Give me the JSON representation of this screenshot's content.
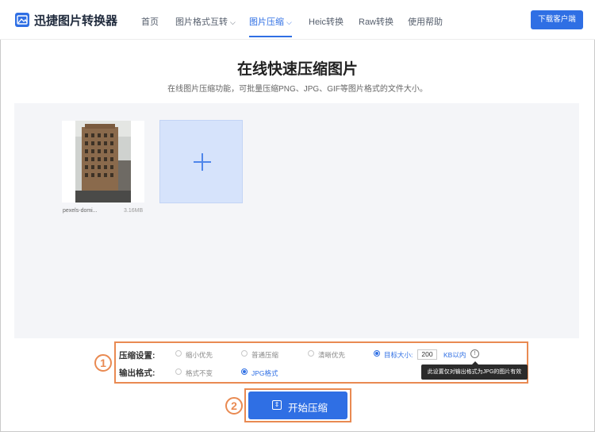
{
  "header": {
    "brand": "迅捷图片转换器",
    "nav": [
      {
        "label": "首页",
        "active": false,
        "dropdown": false
      },
      {
        "label": "图片格式互转",
        "active": false,
        "dropdown": true
      },
      {
        "label": "图片压缩",
        "active": true,
        "dropdown": true
      },
      {
        "label": "Heic转换",
        "active": false,
        "dropdown": false
      },
      {
        "label": "Raw转换",
        "active": false,
        "dropdown": false
      },
      {
        "label": "使用帮助",
        "active": false,
        "dropdown": false
      }
    ],
    "download_label": "下载客户端"
  },
  "page": {
    "title": "在线快速压缩图片",
    "subtitle": "在线图片压缩功能，可批量压缩PNG、JPG、GIF等图片格式的文件大小。"
  },
  "upload": {
    "files": [
      {
        "name": "pexels-domi...",
        "size": "3.16MB"
      }
    ]
  },
  "settings": {
    "step_number": "1",
    "compress_label": "压缩设置:",
    "compress_options": [
      {
        "label": "缩小优先",
        "selected": false
      },
      {
        "label": "普通压缩",
        "selected": false
      },
      {
        "label": "清晰优先",
        "selected": false
      },
      {
        "label": "目标大小:",
        "selected": true
      }
    ],
    "target_size_value": "200",
    "target_size_unit": "KB以内",
    "info_glyph": "!",
    "output_label": "输出格式:",
    "output_options": [
      {
        "label": "格式不变",
        "selected": false
      },
      {
        "label": "JPG格式",
        "selected": true
      }
    ],
    "tooltip": "此设置仅对输出格式为JPG的图片有效"
  },
  "start": {
    "step_number": "2",
    "label": "开始压缩",
    "icon": "compress-icon"
  },
  "colors": {
    "primary": "#2f6fe4",
    "callout": "#e98a52",
    "upload_bg": "#f4f5f8",
    "add_card_bg": "#d6e3fb"
  }
}
